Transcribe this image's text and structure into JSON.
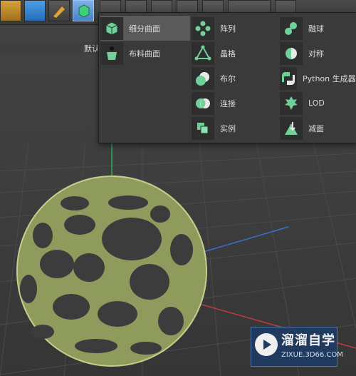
{
  "toolbar": {
    "buttons": [
      {
        "name": "render-settings-icon"
      },
      {
        "name": "cube-icon"
      },
      {
        "name": "pen-icon"
      },
      {
        "name": "subdivision-cube-icon",
        "active": true
      },
      {
        "name": "array-icon"
      },
      {
        "name": "generator-icon"
      },
      {
        "name": "deformer-icon"
      },
      {
        "name": "scene-icon"
      },
      {
        "name": "camera-icon"
      },
      {
        "name": "floor-icon"
      },
      {
        "name": "light-icon"
      }
    ]
  },
  "viewport": {
    "default_label": "默认"
  },
  "menu": {
    "col1": [
      {
        "label": "细分曲面",
        "icon": "subdivision-surface-icon",
        "selected": true
      },
      {
        "label": "布料曲面",
        "icon": "cloth-surface-icon"
      }
    ],
    "col2": [
      {
        "label": "阵列",
        "icon": "array-icon"
      },
      {
        "label": "晶格",
        "icon": "atom-array-icon"
      },
      {
        "label": "布尔",
        "icon": "boole-icon"
      },
      {
        "label": "连接",
        "icon": "connect-icon"
      },
      {
        "label": "实例",
        "icon": "instance-icon"
      }
    ],
    "col3": [
      {
        "label": "融球",
        "icon": "metaball-icon"
      },
      {
        "label": "对称",
        "icon": "symmetry-icon"
      },
      {
        "label": "Python 生成器",
        "icon": "python-generator-icon"
      },
      {
        "label": "LOD",
        "icon": "lod-icon"
      },
      {
        "label": "减面",
        "icon": "polygon-reduction-icon"
      }
    ]
  },
  "watermark": {
    "title": "溜溜自学",
    "url": "ZIXUE.3D66.COM"
  },
  "colors": {
    "accent_green": "#6fd09a",
    "sphere": "#a7b471",
    "selected_bg": "#5a5a5a"
  }
}
